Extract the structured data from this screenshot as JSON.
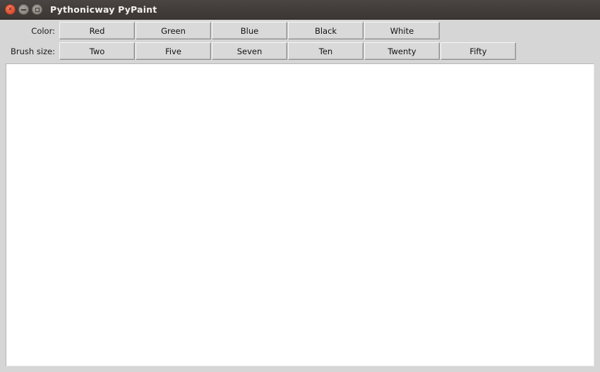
{
  "window": {
    "title": "Pythonicway PyPaint",
    "controls": [
      {
        "name": "close",
        "glyph": "×"
      },
      {
        "name": "minimize",
        "glyph": ""
      },
      {
        "name": "maximize",
        "glyph": ""
      }
    ]
  },
  "toolbar": {
    "color_row": {
      "label": "Color:",
      "buttons": [
        {
          "label": "Red"
        },
        {
          "label": "Green"
        },
        {
          "label": "Blue"
        },
        {
          "label": "Black"
        },
        {
          "label": "White"
        }
      ]
    },
    "brush_row": {
      "label": "Brush size:",
      "buttons": [
        {
          "label": "Two"
        },
        {
          "label": "Five"
        },
        {
          "label": "Seven"
        },
        {
          "label": "Ten"
        },
        {
          "label": "Twenty"
        },
        {
          "label": "Fifty"
        }
      ]
    }
  },
  "canvas": {
    "content": ""
  },
  "colors": {
    "titlebar": "#423d3a",
    "title_text": "#f2f0ee",
    "close_button": "#e2573a",
    "window_button": "#918a85",
    "toolbar_bg": "#d6d6d6",
    "button_face": "#d9d9d9",
    "canvas_bg": "#ffffff"
  }
}
